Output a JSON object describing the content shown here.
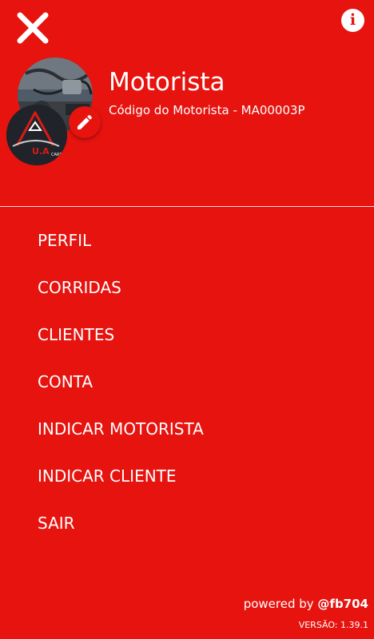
{
  "header": {
    "close_icon": "close-icon",
    "info_icon": "info-icon",
    "info_glyph": "i"
  },
  "profile": {
    "name": "Motorista",
    "code_label": "Código do Motorista - MA00003P",
    "edit_icon": "pencil-icon",
    "logo_text": "U.A",
    "logo_subtext": "CARS"
  },
  "menu": {
    "items": [
      {
        "label": "PERFIL"
      },
      {
        "label": "CORRIDAS"
      },
      {
        "label": "CLIENTES"
      },
      {
        "label": "CONTA"
      },
      {
        "label": "INDICAR MOTORISTA"
      },
      {
        "label": "INDICAR CLIENTE"
      },
      {
        "label": "SAIR"
      }
    ]
  },
  "footer": {
    "powered_prefix": "powered by ",
    "powered_handle": "@fb704",
    "version": "VERSÃO: 1.39.1"
  },
  "colors": {
    "background": "#e6130f",
    "text": "#ffffff",
    "logo_bg": "#202329",
    "logo_accent": "#d81b16"
  }
}
